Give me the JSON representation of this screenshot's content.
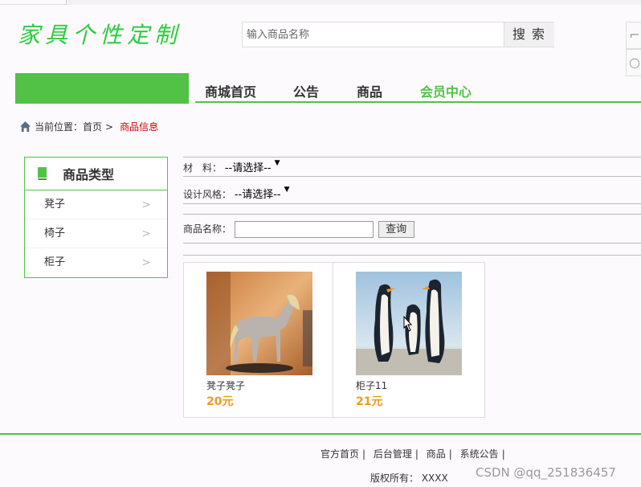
{
  "header": {
    "logo_text": "家具个性定制",
    "search_placeholder": "输入商品名称",
    "search_button": "搜索"
  },
  "nav": {
    "items": [
      {
        "label": "商城首页",
        "active": false
      },
      {
        "label": "公告",
        "active": false
      },
      {
        "label": "商品",
        "active": false
      },
      {
        "label": "会员中心",
        "active": true
      }
    ]
  },
  "breadcrumb": {
    "prefix": "当前位置：",
    "home": "首页",
    "separator": ">",
    "current": "商品信息"
  },
  "categories": {
    "title": "商品类型",
    "items": [
      "凳子",
      "椅子",
      "柜子"
    ]
  },
  "filters": {
    "material_label": "材　料：",
    "material_value": "--请选择--",
    "style_label": "设计风格：",
    "style_value": "--请选择--",
    "name_label": "商品名称：",
    "name_value": "",
    "query_button": "查询"
  },
  "products": [
    {
      "name": "凳子凳子",
      "price": "20元",
      "image": "horse-figurine"
    },
    {
      "name": "柜子11",
      "price": "21元",
      "image": "penguins"
    }
  ],
  "footer": {
    "links": [
      "官方首页",
      "后台管理",
      "商品",
      "系统公告"
    ],
    "separator": "|",
    "copyright": "版权所有：  XXXX"
  },
  "watermark": "CSDN @qq_251836457",
  "colors": {
    "accent_green": "#52c247",
    "logo_green": "#2ecc40",
    "price_orange": "#f29a1a",
    "crumb_red": "#cc0000"
  }
}
